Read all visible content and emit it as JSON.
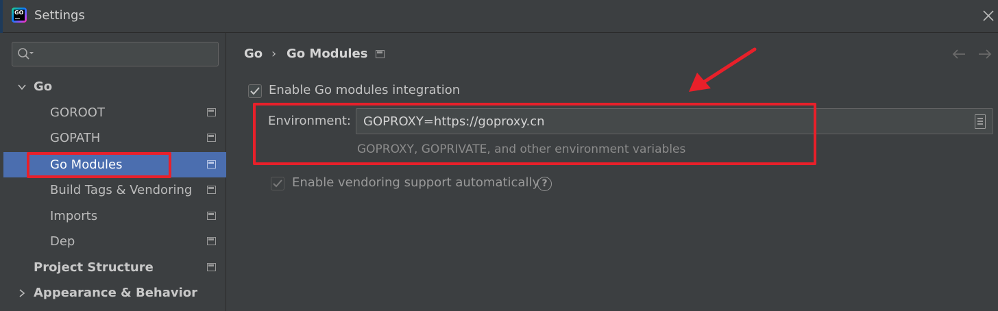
{
  "window": {
    "title": "Settings",
    "logo_text": "GO"
  },
  "search": {
    "placeholder": "",
    "value": ""
  },
  "tree": {
    "items": [
      {
        "label": "Go",
        "level": 0,
        "expanded": true,
        "selected": false
      },
      {
        "label": "GOROOT",
        "level": 1,
        "selected": false
      },
      {
        "label": "GOPATH",
        "level": 1,
        "selected": false
      },
      {
        "label": "Go Modules",
        "level": 1,
        "selected": true
      },
      {
        "label": "Build Tags & Vendoring",
        "level": 1,
        "selected": false
      },
      {
        "label": "Imports",
        "level": 1,
        "selected": false
      },
      {
        "label": "Dep",
        "level": 1,
        "selected": false
      },
      {
        "label": "Project Structure",
        "level": 0,
        "selected": false
      },
      {
        "label": "Appearance & Behavior",
        "level": 0,
        "expanded": false,
        "selected": false
      }
    ]
  },
  "breadcrumb": {
    "root": "Go",
    "separator": "›",
    "current": "Go Modules"
  },
  "settings": {
    "enable_modules_label": "Enable Go modules integration",
    "enable_modules_checked": true,
    "environment_label": "Environment:",
    "environment_value": "GOPROXY=https://goproxy.cn",
    "environment_hint": "GOPROXY, GOPRIVATE, and other environment variables",
    "vendoring_label": "Enable vendoring support automatically",
    "vendoring_checked": true,
    "vendoring_enabled": false
  },
  "colors": {
    "background": "#3c3f41",
    "selection": "#4b6eaf",
    "annotation_red": "#e8202a",
    "field_background": "#45494a"
  }
}
